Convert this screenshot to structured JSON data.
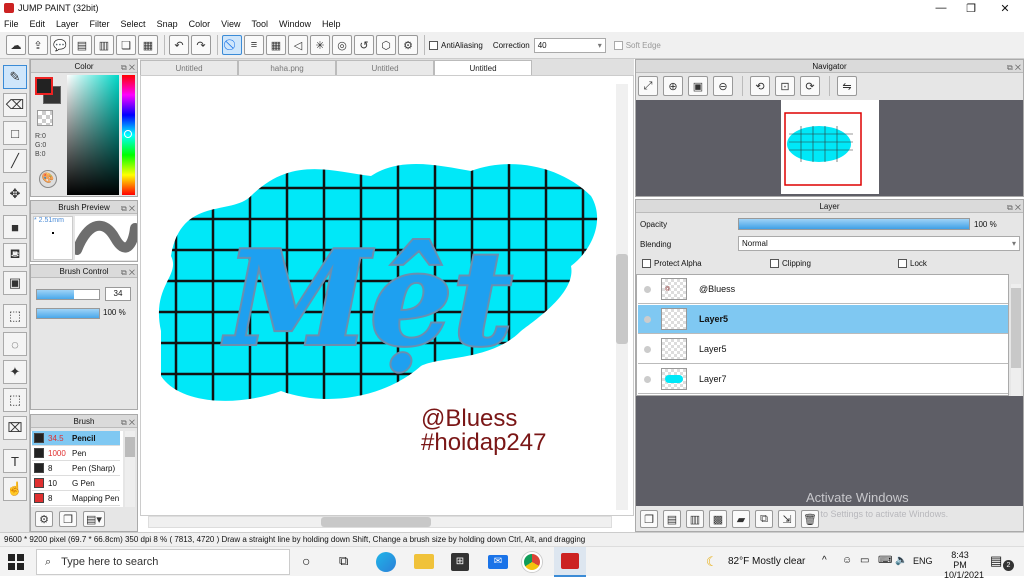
{
  "window": {
    "title": "JUMP PAINT (32bit)"
  },
  "menu": [
    "File",
    "Edit",
    "Layer",
    "Filter",
    "Select",
    "Snap",
    "Color",
    "View",
    "Tool",
    "Window",
    "Help"
  ],
  "toolbar": {
    "antialias_label": "AntiAliasing",
    "correction_label": "Correction",
    "correction_value": "40",
    "softedge_label": "Soft Edge"
  },
  "color_panel": {
    "title": "Color",
    "r": "R:0",
    "g": "G:0",
    "b": "B:0"
  },
  "brush_preview": {
    "title": "Brush Preview",
    "size": "* 2.51mm"
  },
  "brush_control": {
    "title": "Brush Control",
    "size_value": "34",
    "opacity_value": "100 %"
  },
  "brush_panel": {
    "title": "Brush",
    "items": [
      {
        "size": "34.5",
        "name": "Pencil",
        "color": "#222222",
        "selected": true
      },
      {
        "size": "1000",
        "name": "Pen",
        "color": "#222222",
        "selected": false
      },
      {
        "size": "8",
        "name": "Pen (Sharp)",
        "color": "#222222",
        "selected": false
      },
      {
        "size": "10",
        "name": "G Pen",
        "color": "#e03030",
        "selected": false
      },
      {
        "size": "8",
        "name": "Mapping Pen",
        "color": "#e03030",
        "selected": false
      }
    ]
  },
  "tabs": [
    "Untitled",
    "haha.png",
    "Untitled",
    "Untitled"
  ],
  "artwork": {
    "title_text": "Mệt",
    "signature_1": "@Bluess",
    "signature_2": "#hoidap247"
  },
  "navigator": {
    "title": "Navigator"
  },
  "layer_panel": {
    "title": "Layer",
    "opacity_label": "Opacity",
    "opacity_value": "100 %",
    "blending_label": "Blending",
    "blending_value": "Normal",
    "protect_alpha": "Protect Alpha",
    "clipping": "Clipping",
    "lock": "Lock",
    "layers": [
      {
        "name": "@Bluess",
        "selected": false
      },
      {
        "name": "Layer5",
        "selected": true
      },
      {
        "name": "Layer5",
        "selected": false
      },
      {
        "name": "Layer7",
        "selected": false
      }
    ]
  },
  "watermark": {
    "line1": "Activate Windows",
    "line2": "Go to Settings to activate Windows."
  },
  "statusbar": "9600 * 9200 pixel   (69.7 * 66.8cm)   350 dpi   8 %   ( 7813, 4720 )   Draw a straight line by holding down Shift, Change a brush size by holding down Ctrl, Alt, and dragging",
  "taskbar": {
    "search_placeholder": "Type here to search",
    "weather": "82°F  Mostly clear",
    "lang": "ENG",
    "time": "8:43 PM",
    "date": "10/1/2021",
    "notif_count": "2"
  },
  "colors": {
    "accent": "#7fc8f2",
    "cyan": "#00e5ff",
    "blob": "#00e8f8"
  }
}
